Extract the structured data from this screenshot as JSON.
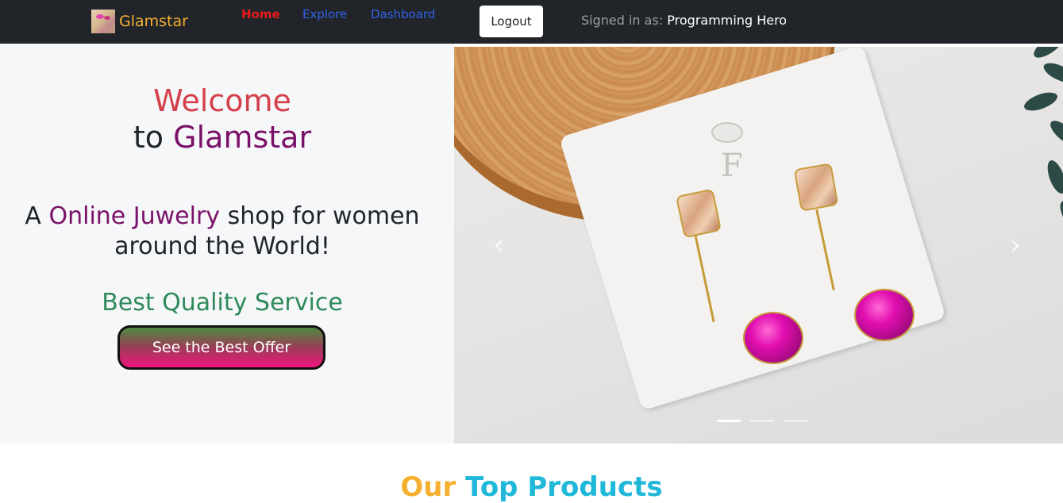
{
  "navbar": {
    "brand_name": "Glamstar",
    "links": [
      {
        "label": "Home"
      },
      {
        "label": "Explore"
      },
      {
        "label": "Dashboard"
      }
    ],
    "logout_label": "Logout",
    "signed_in_prefix": "Signed in as:",
    "user_name": "Programming Hero"
  },
  "hero": {
    "welcome": "Welcome",
    "to": "to",
    "brand": "Glamstar",
    "tagline_a": "A",
    "tagline_highlight": "Online Juwelry",
    "tagline_b": "shop for women",
    "tagline_line2": "around the World!",
    "quality": "Best Quality Service",
    "button_label": "See the Best Offer"
  },
  "carousel": {
    "image": "earrings-on-card",
    "card_letter": "F",
    "prev_icon": "chevron-left-icon",
    "next_icon": "chevron-right-icon",
    "prev_glyph": "‹",
    "next_glyph": "›",
    "slide_count": 3,
    "active_index": 0
  },
  "products_section": {
    "title_word1": "Our",
    "title_word2": "Top Products"
  },
  "colors": {
    "navbar_bg": "#212529",
    "brand": "#f5b031",
    "home_active": "#ea1a1a",
    "nav_link": "#2f62e8",
    "welcome": "#d43f4a",
    "brand_purple": "#7a1068",
    "quality_green": "#2e8a5a",
    "button_gradient_top": "#4f8a3e",
    "button_gradient_bottom": "#f0147e"
  }
}
